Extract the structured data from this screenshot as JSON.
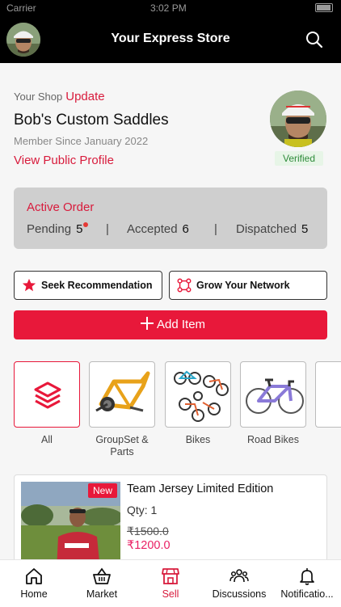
{
  "status_bar": {
    "carrier": "Carrier",
    "time": "3:02 PM"
  },
  "header": {
    "title": "Your Express Store",
    "avatar_icon": "profile-photo-cyclist",
    "search_icon": "search-icon"
  },
  "shop": {
    "label": "Your Shop",
    "update_link": "Update",
    "name": "Bob's Custom Saddles",
    "member_since": "Member Since January 2022",
    "view_profile": "View Public Profile",
    "verified_badge": "Verified"
  },
  "orders": {
    "title": "Active Order",
    "pending_label": "Pending",
    "pending_count": "5",
    "accepted_label": "Accepted",
    "accepted_count": "6",
    "dispatched_label": "Dispatched",
    "dispatched_count": "5",
    "separator": "|"
  },
  "actions": {
    "seek_recommendation": "Seek Recommendation",
    "grow_network": "Grow Your Network",
    "add_item": "Add Item"
  },
  "categories": [
    {
      "label": "All",
      "icon": "layers-icon",
      "selected": true
    },
    {
      "label": "GroupSet & Parts",
      "icon": "bike-frame-image"
    },
    {
      "label": "Bikes",
      "icon": "bikes-collage-image"
    },
    {
      "label": "Road Bikes",
      "icon": "road-bike-image"
    },
    {
      "label": "",
      "icon": "partial-category"
    }
  ],
  "product": {
    "badge": "New",
    "name": "Team Jersey Limited Edition",
    "qty": "Qty: 1",
    "old_price": "₹1500.0",
    "new_price": "₹1200.0"
  },
  "tabs": [
    {
      "label": "Home",
      "icon": "home-icon"
    },
    {
      "label": "Market",
      "icon": "basket-icon"
    },
    {
      "label": "Sell",
      "icon": "store-icon",
      "active": true
    },
    {
      "label": "Discussions",
      "icon": "people-icon"
    },
    {
      "label": "Notificatio...",
      "icon": "bell-icon"
    }
  ],
  "colors": {
    "accent": "#e8183a",
    "header_bg": "#000000",
    "verified_green": "#2e8b3a",
    "price_pink": "#e91e63"
  }
}
